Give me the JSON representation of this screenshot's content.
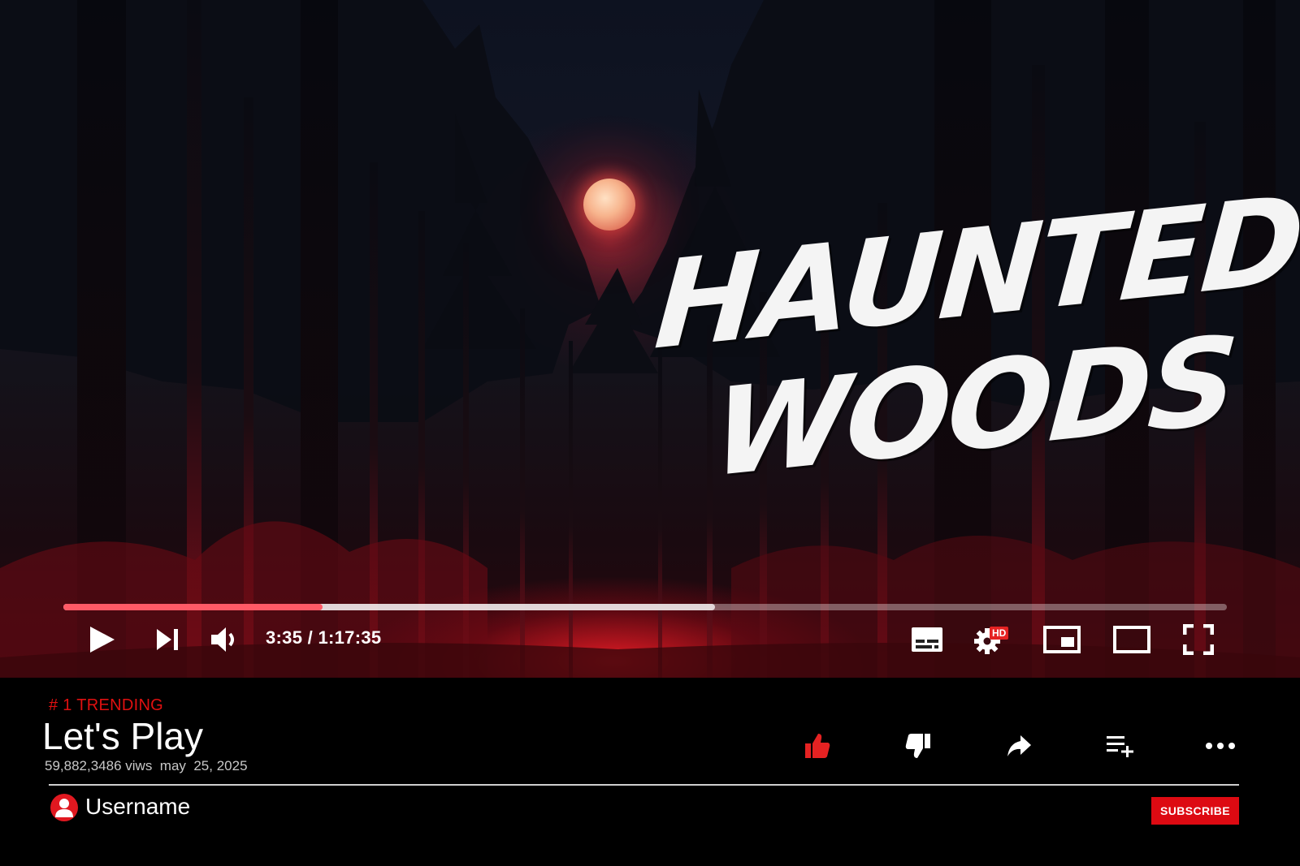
{
  "thumbnail": {
    "title_line1": "HAUNTED",
    "title_line2": "WOODS"
  },
  "player": {
    "current_time": "3:35",
    "separator": " / ",
    "duration": "1:17:35",
    "time_display": "3:35 / 1:17:35",
    "progress_played_fraction": 0.223,
    "progress_buffered_fraction": 0.56,
    "quality_badge": "HD",
    "controls": [
      "play-icon",
      "next-icon",
      "volume-icon",
      "captions-icon",
      "settings-icon",
      "miniplayer-icon",
      "theater-icon",
      "fullscreen-icon"
    ]
  },
  "video_info": {
    "trending": "# 1 TRENDING",
    "title": "Let's Play",
    "views": "59,882,3486 viws",
    "date": "may  25, 2025",
    "actions": [
      "like-icon",
      "dislike-icon",
      "share-icon",
      "save-to-playlist-icon",
      "more-icon"
    ]
  },
  "channel": {
    "name": "Username",
    "subscribe_label": "SUBSCRIBE"
  },
  "colors": {
    "accent_red": "#e01010",
    "progress_played": "#ff5a66",
    "subscribe_bg": "#dd0a12",
    "like_active": "#e52222"
  }
}
